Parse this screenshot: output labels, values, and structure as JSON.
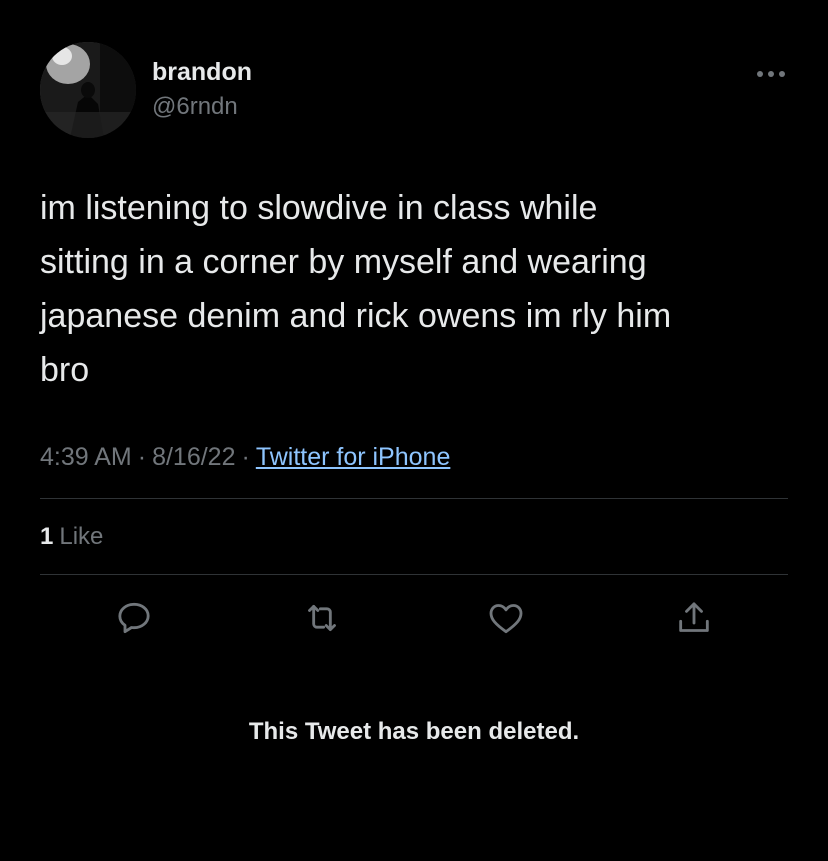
{
  "author": {
    "display_name": "brandon",
    "handle": "@6rndn"
  },
  "tweet": {
    "text": "im listening to slowdive in class while\nsitting in a corner by myself and wearing\njapanese denim and rick owens im rly him\nbro",
    "time": "4:39 AM",
    "date": "8/16/22",
    "separator": "·",
    "source": "Twitter for iPhone"
  },
  "stats": {
    "like_count": "1",
    "like_label": "Like"
  },
  "actions": {
    "reply_icon": "reply-icon",
    "retweet_icon": "retweet-icon",
    "like_icon": "heart-icon",
    "share_icon": "share-icon",
    "more_icon": "more-icon"
  },
  "notice": {
    "text": "This Tweet has been deleted."
  },
  "colors": {
    "background": "#000000",
    "primary_text": "#e7e9ea",
    "secondary_text": "#71767b",
    "link": "#8ec5ff",
    "divider": "#2f3336"
  }
}
